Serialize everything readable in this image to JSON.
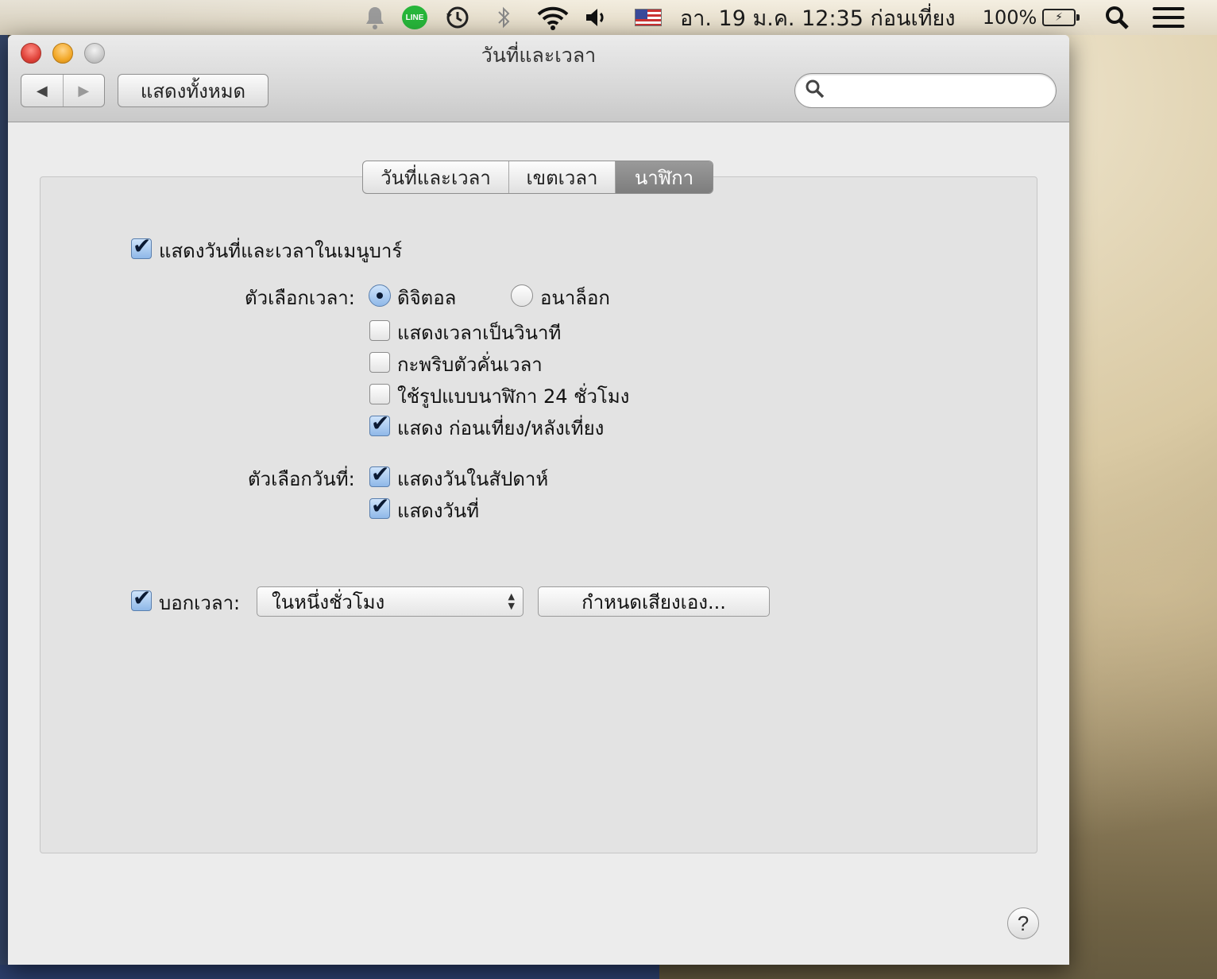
{
  "menubar": {
    "line_label": "LINE",
    "clock": "อา. 19 ม.ค.  12:35 ก่อนเที่ยง",
    "battery_pct": "100%"
  },
  "window": {
    "title": "วันที่และเวลา",
    "back_arrow": "◀",
    "forward_arrow": "▶",
    "show_all": "แสดงทั้งหมด",
    "search_placeholder": "",
    "search_value": ""
  },
  "tabs": [
    {
      "label": "วันที่และเวลา",
      "selected": false
    },
    {
      "label": "เขตเวลา",
      "selected": false
    },
    {
      "label": "นาฬิกา",
      "selected": true
    }
  ],
  "clock_pane": {
    "show_in_menubar": {
      "label": "แสดงวันที่และเวลาในเมนูบาร์",
      "checked": true
    },
    "time_options_label": "ตัวเลือกเวลา:",
    "digital": {
      "label": "ดิจิตอล",
      "selected": true
    },
    "analog": {
      "label": "อนาล็อก",
      "selected": false
    },
    "show_seconds": {
      "label": "แสดงเวลาเป็นวินาที",
      "checked": false
    },
    "flash_separators": {
      "label": "กะพริบตัวคั่นเวลา",
      "checked": false
    },
    "use_24h": {
      "label": "ใช้รูปแบบนาฬิกา 24 ชั่วโมง",
      "checked": false
    },
    "show_ampm": {
      "label": "แสดง ก่อนเที่ยง/หลังเที่ยง",
      "checked": true
    },
    "date_options_label": "ตัวเลือกวันที่:",
    "show_day_of_week": {
      "label": "แสดงวันในสัปดาห์",
      "checked": true
    },
    "show_date": {
      "label": "แสดงวันที่",
      "checked": true
    },
    "announce_time": {
      "label": "บอกเวลา:",
      "checked": true
    },
    "announce_interval": "ในหนึ่งชั่วโมง",
    "customize_voice": "กำหนดเสียงเอง..."
  },
  "help_label": "?"
}
